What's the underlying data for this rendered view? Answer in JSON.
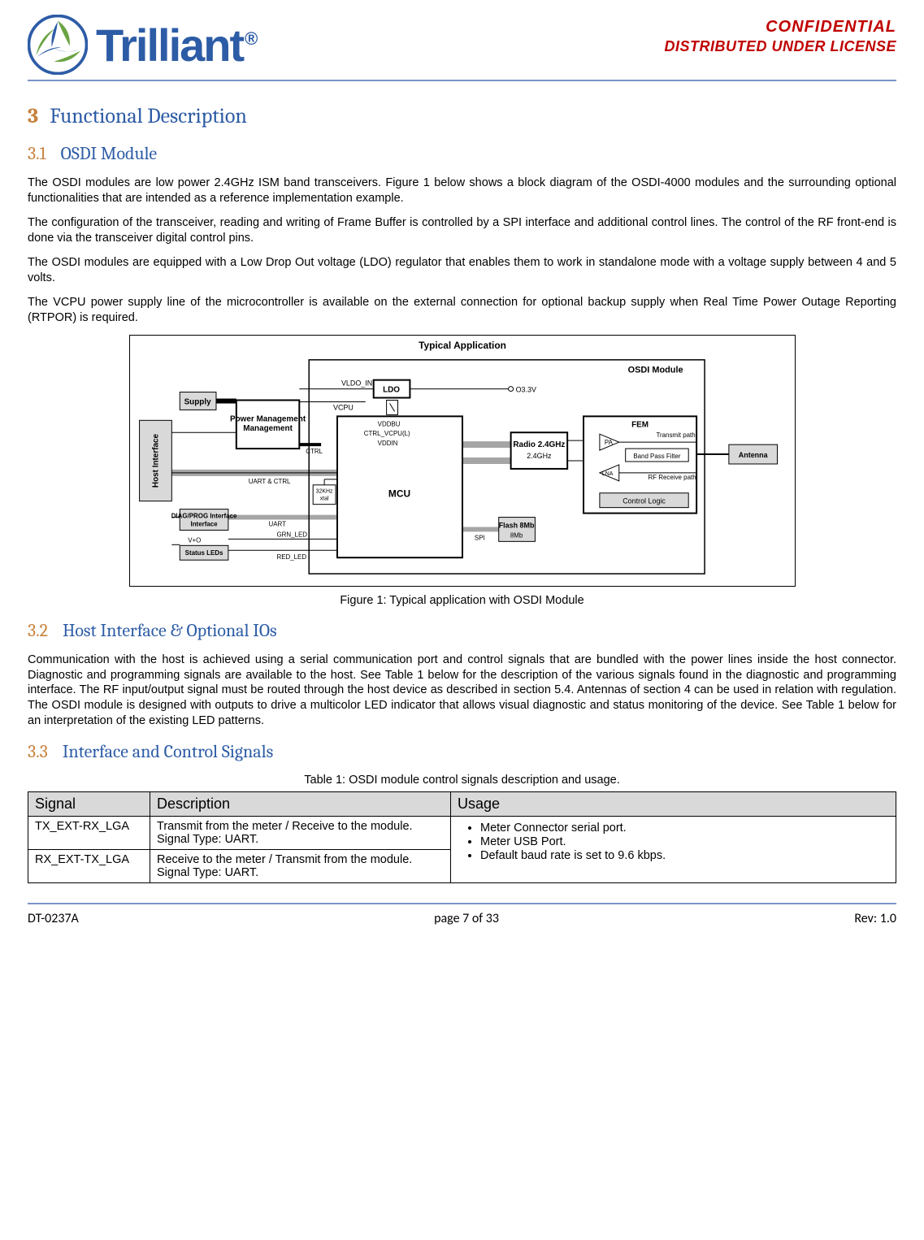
{
  "header": {
    "logo_text": "Trilliant",
    "trade": "®",
    "confidential": "CONFIDENTIAL",
    "licensed": "DISTRIBUTED UNDER LICENSE"
  },
  "sections": {
    "s3": {
      "num": "3",
      "title": "Functional Description"
    },
    "s31": {
      "num": "3.1",
      "title": "OSDI Module"
    },
    "s32": {
      "num": "3.2",
      "title": "Host Interface & Optional IOs"
    },
    "s33": {
      "num": "3.3",
      "title": "Interface and Control Signals"
    }
  },
  "paras": {
    "p1": "The OSDI modules are low power 2.4GHz ISM band transceivers. Figure 1 below shows a block diagram of the OSDI-4000 modules and the surrounding optional functionalities that are intended as a reference implementation example.",
    "p2": "The configuration of the transceiver, reading and writing of Frame Buffer is controlled by a SPI interface and additional control lines. The control of the RF front-end is done via the transceiver digital control pins.",
    "p3": "The OSDI modules are equipped with a Low Drop Out voltage (LDO) regulator that enables them to work in standalone mode with a voltage supply between 4 and 5 volts.",
    "p4": "The VCPU power supply line of the microcontroller is available on the external connection for optional backup supply when Real Time Power Outage Reporting (RTPOR) is required.",
    "p5": "Communication with the host is achieved using a serial communication port and control signals that are bundled with the power lines inside the host connector. Diagnostic and programming signals are available to the host.  See Table 1 below for the description of the various signals found in the diagnostic and programming interface.  The RF input/output signal must be routed through the host device as described in section 5.4.  Antennas of section 4 can be used in relation with regulation.   The OSDI module is designed with outputs to drive a multicolor LED indicator that allows visual diagnostic and status monitoring of the device. See Table 1 below for an interpretation of the existing LED patterns."
  },
  "figure": {
    "caption": "Figure 1: Typical application with OSDI Module",
    "title": "Typical Application",
    "module_label": "OSDI Module",
    "blocks": {
      "host": "Host Interface",
      "supply": "Supply",
      "diag": "DIAG/PROG Interface",
      "leds": "Status LEDs",
      "pm": "Power Management",
      "ldo": "LDO",
      "mcu": "MCU",
      "xtal": "32KHz xtal",
      "flash": "Flash 8Mb",
      "radio": "Radio 2.4GHz",
      "fem": "FEM",
      "pa": "PA",
      "lna": "LNA",
      "bpf": "Band Pass Filter",
      "ctrl": "Control Logic",
      "ant": "Antenna"
    },
    "signals": {
      "vldo_in": "VLDO_IN",
      "vcpu": "VCPU",
      "ctrl": "CTRL",
      "uart_ctrl": "UART & CTRL",
      "uart": "UART",
      "grn": "GRN_LED",
      "red": "RED_LED",
      "vddbu": "VDDBU",
      "ctrl_vcpu": "CTRL_VCPU(L)",
      "vddin": "VDDIN",
      "o33": "O3.3V",
      "spi": "SPI",
      "txpath": "Transmit path",
      "rxpath": "RF Receive path",
      "vplus": "V+O"
    }
  },
  "table": {
    "caption": "Table 1: OSDI module control signals description and usage.",
    "headers": {
      "sig": "Signal",
      "desc": "Description",
      "usage": "Usage"
    },
    "rows": [
      {
        "signal": "TX_EXT-RX_LGA",
        "desc_l1": "Transmit from the meter / Receive to the module.",
        "desc_l2": "Signal Type: UART."
      },
      {
        "signal": "RX_EXT-TX_LGA",
        "desc_l1": "Receive to the meter / Transmit from the module.",
        "desc_l2": "Signal Type: UART."
      }
    ],
    "usage_items": [
      "Meter Connector serial port.",
      "Meter USB Port.",
      "Default baud rate is set to 9.6 kbps."
    ]
  },
  "footer": {
    "left": "DT-0237A",
    "center": "page 7 of 33",
    "right": "Rev: 1.0"
  }
}
